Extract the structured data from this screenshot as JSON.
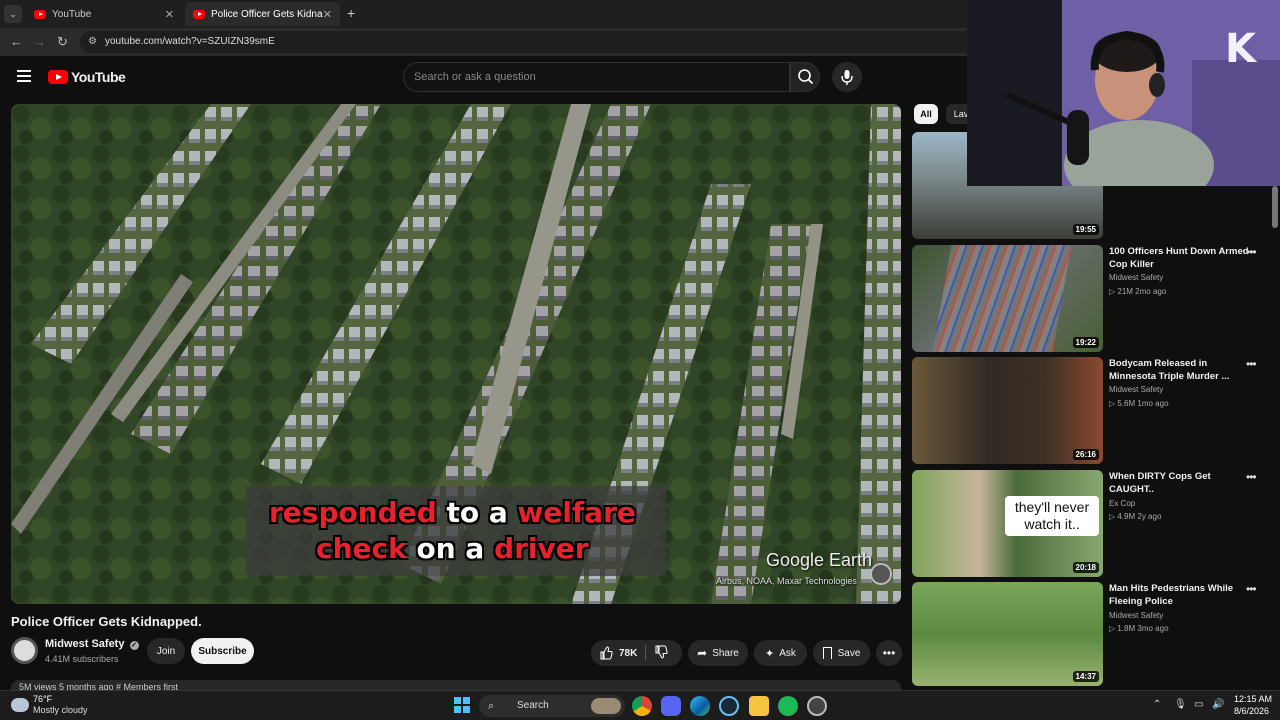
{
  "browser": {
    "tabs": [
      {
        "label": "YouTube",
        "active": false
      },
      {
        "label": "Police Officer Gets Kidnapped.",
        "active": true
      }
    ],
    "new_tab": "+",
    "url": "youtube.com/watch?v=SZUIZN39smE"
  },
  "header": {
    "logo": "YouTube",
    "search_placeholder": "Search or ask a question"
  },
  "video": {
    "caption_line1": [
      "responded",
      "to a",
      "welfare"
    ],
    "caption_line2": [
      "check",
      "on a",
      "driver"
    ],
    "watermark": "Google Earth",
    "credit": "Airbus, NOAA, Maxar Technologies",
    "title": "Police Officer Gets Kidnapped."
  },
  "channel": {
    "name": "Midwest Safety",
    "subscribers": "4.41M subscribers",
    "join_label": "Join",
    "subscribe_label": "Subscribe"
  },
  "actions": {
    "likes": "78K",
    "share": "Share",
    "ask": "Ask",
    "save": "Save"
  },
  "description": {
    "meta": "5M views  5 months ago  #  Members first"
  },
  "sidebar": {
    "chips": [
      "All",
      "Lav"
    ],
    "items": [
      {
        "title": "",
        "channel": "",
        "meta": "",
        "duration": "19:55"
      },
      {
        "title": "100 Officers Hunt Down Armed Cop Killer",
        "channel": "Midwest Safety",
        "meta": "21M  2mo ago",
        "duration": "19:22"
      },
      {
        "title": "Bodycam Released in Minnesota Triple Murder ...",
        "channel": "Midwest Safety",
        "meta": "5.6M  1mo ago",
        "duration": "26:16"
      },
      {
        "title": "When DIRTY Cops Get CAUGHT..",
        "channel": "Ex Cop",
        "meta": "4.9M  2y ago",
        "duration": "20:18",
        "thumb_text": "they'll never watch it.."
      },
      {
        "title": "Man Hits Pedestrians While Fleeing Police",
        "channel": "Midwest Safety",
        "meta": "1.8M  3mo ago",
        "duration": "14:37"
      }
    ]
  },
  "taskbar": {
    "weather_temp": "76°F",
    "weather_desc": "Mostly cloudy",
    "search_label": "Search",
    "time": "12:15 AM",
    "date": "8/6/2026"
  },
  "colors": {
    "youtube_red": "#ff0000",
    "caption_red": "#e8212d",
    "background": "#0f0f0f"
  }
}
